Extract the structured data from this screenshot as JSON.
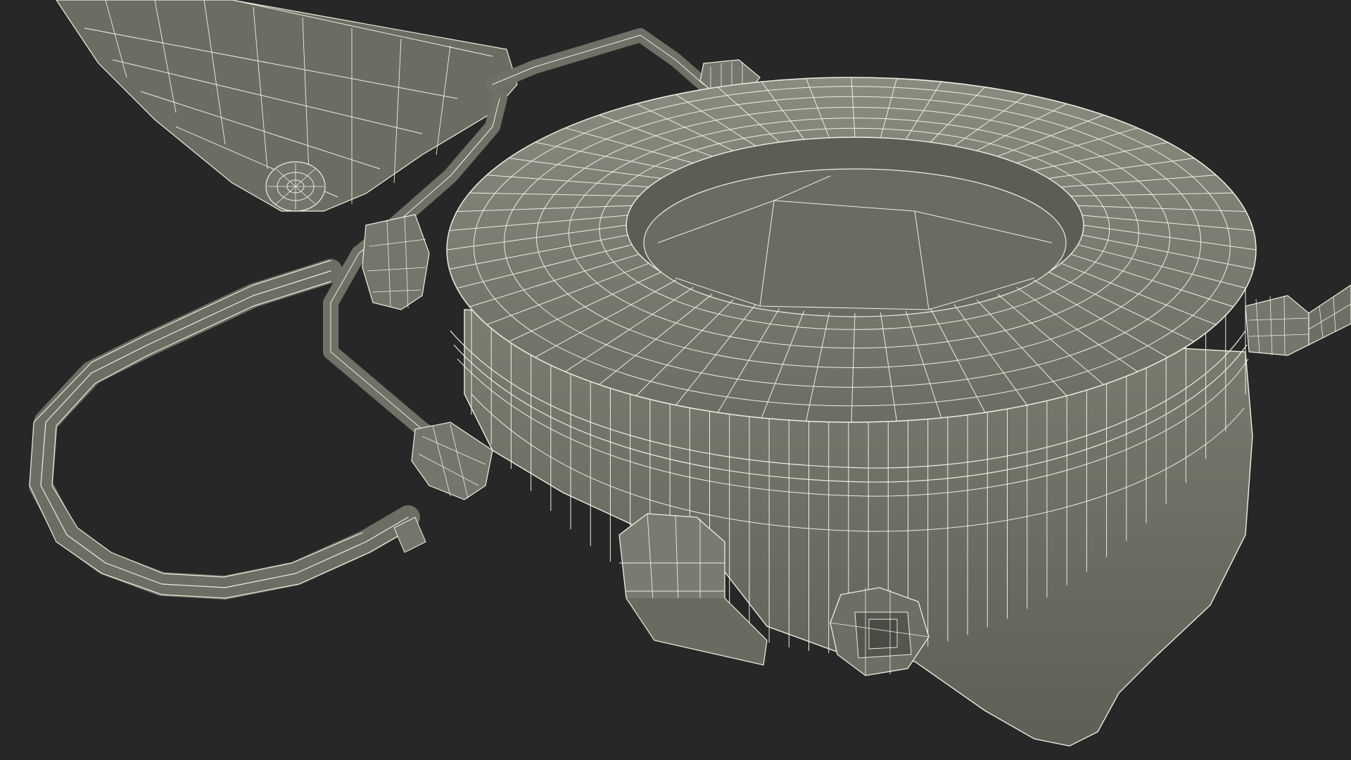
{
  "scene": {
    "subject": "wireframe-headset-render",
    "colors": {
      "background": "#272727",
      "surface": "#7a7b6f",
      "surface_light": "#8a8b7e",
      "surface_dark": "#5f6056",
      "wire": "#f2f2e6"
    }
  }
}
